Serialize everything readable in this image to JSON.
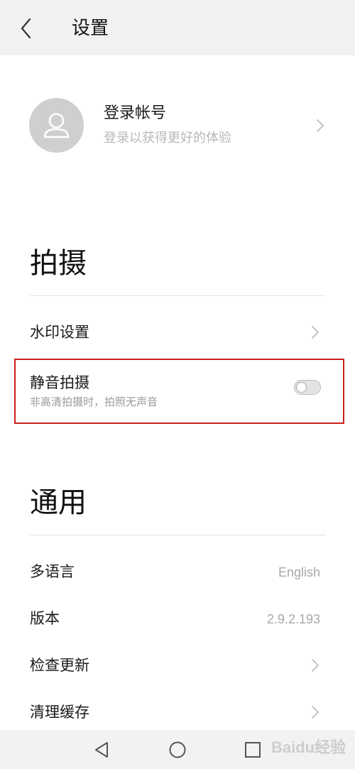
{
  "header": {
    "title": "设置",
    "back_icon": "chevron-left-icon"
  },
  "account": {
    "title": "登录帐号",
    "subtitle": "登录以获得更好的体验",
    "avatar_icon": "user-icon"
  },
  "sections": {
    "shooting": {
      "title": "拍摄",
      "watermark_label": "水印设置",
      "silent_label": "静音拍摄",
      "silent_subtitle": "非高清拍摄时，拍照无声音",
      "silent_enabled": false
    },
    "general": {
      "title": "通用",
      "language_label": "多语言",
      "language_value": "English",
      "version_label": "版本",
      "version_value": "2.9.2.193",
      "check_update_label": "检查更新",
      "clear_cache_label": "清理缓存"
    }
  },
  "navbar": {
    "back_icon": "triangle-back-icon",
    "home_icon": "circle-home-icon",
    "recents_icon": "square-recents-icon"
  },
  "watermark": {
    "text": "Baidu经验"
  },
  "colors": {
    "header_bg": "#f2f2f2",
    "highlight_border": "#cc1f1f",
    "secondary_text": "#b8b8b8"
  }
}
